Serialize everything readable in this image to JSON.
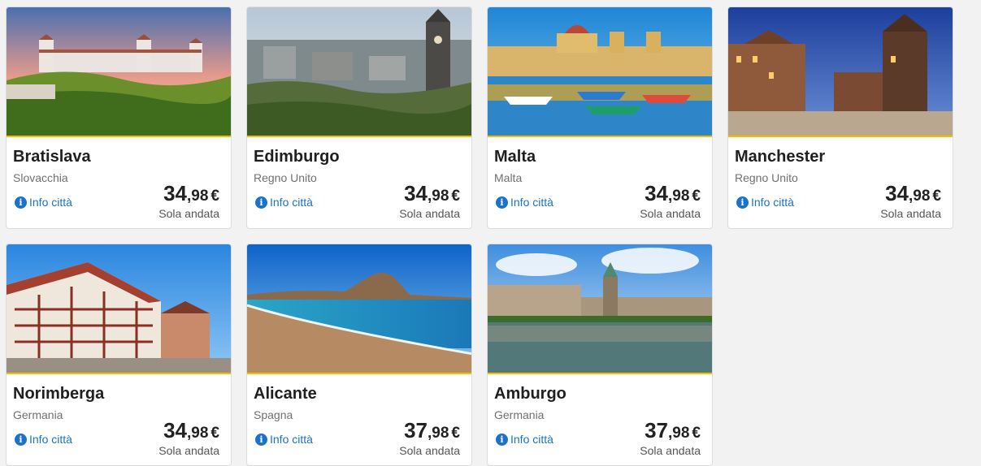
{
  "info_label": "Info città",
  "currency": "€",
  "oneway_label": "Sola andata",
  "accent_color": "#f2c200",
  "link_color": "#1a73c9",
  "destinations": [
    {
      "city": "Bratislava",
      "country": "Slovacchia",
      "price_int": "34",
      "price_dec": ",98",
      "image": "castle-sunset"
    },
    {
      "city": "Edimburgo",
      "country": "Regno Unito",
      "price_int": "34",
      "price_dec": ",98",
      "image": "old-town-clocktower"
    },
    {
      "city": "Malta",
      "country": "Malta",
      "price_int": "34",
      "price_dec": ",98",
      "image": "harbour-boats"
    },
    {
      "city": "Manchester",
      "country": "Regno Unito",
      "price_int": "34",
      "price_dec": ",98",
      "image": "town-hall-dusk"
    },
    {
      "city": "Norimberga",
      "country": "Germania",
      "price_int": "34",
      "price_dec": ",98",
      "image": "timbered-house"
    },
    {
      "city": "Alicante",
      "country": "Spagna",
      "price_int": "37",
      "price_dec": ",98",
      "image": "beach-headland"
    },
    {
      "city": "Amburgo",
      "country": "Germania",
      "price_int": "37",
      "price_dec": ",98",
      "image": "lake-city-hall"
    }
  ]
}
